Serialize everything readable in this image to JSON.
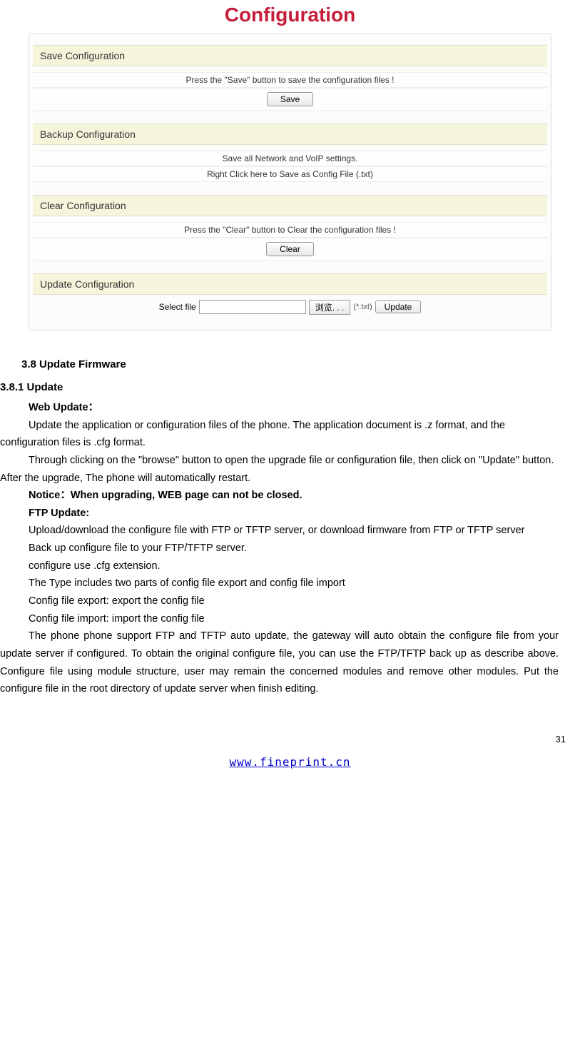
{
  "config": {
    "title": "Configuration",
    "save": {
      "header": "Save Configuration",
      "instruction": "Press the \"Save\" button to save the configuration files !",
      "button": "Save"
    },
    "backup": {
      "header": "Backup Configuration",
      "line1": "Save all Network and VoIP settings.",
      "line2": "Right Click here to Save as Config File (.txt)"
    },
    "clear": {
      "header": "Clear Configuration",
      "instruction": "Press the \"Clear\" button to Clear the configuration files !",
      "button": "Clear"
    },
    "update": {
      "header": "Update Configuration",
      "label": "Select file",
      "browse": "浏览. . .",
      "ext": "(*.txt)",
      "button": "Update"
    }
  },
  "doc": {
    "h38": "3.8 Update Firmware",
    "h381": "3.8.1 Update",
    "web_update_label": "Web Update：",
    "web_p1": "Update the application or configuration files of the phone. The application document is .z format, and the configuration files is .cfg format.",
    "web_p2": "Through clicking on the \"browse\" button to open the upgrade file or configuration file, then click on \"Update\" button. After the upgrade, The phone will automatically restart.",
    "notice": "Notice：When upgrading, WEB page can not be closed.",
    "ftp_label": "FTP Update:",
    "ftp_p1": "Upload/download the configure file with FTP or TFTP server, or download firmware from FTP or TFTP server",
    "ftp_p2": "Back up configure file to your FTP/TFTP server.",
    "ftp_p3": "configure use .cfg extension.",
    "ftp_p4": "The Type includes two parts of config file export and config file import",
    "ftp_p5": "Config file export: export the config file",
    "ftp_p6": "Config file import: import the config file",
    "ftp_p7": "The phone phone support FTP and TFTP auto update, the gateway will auto obtain the configure file from your update server if configured. To obtain the original configure file, you can use the FTP/TFTP back up as describe above. Configure file using module structure, user may remain the concerned modules and remove other modules. Put the configure file in the root directory of update server when finish editing."
  },
  "page_number": "31",
  "footer_url": "www.fineprint.cn"
}
